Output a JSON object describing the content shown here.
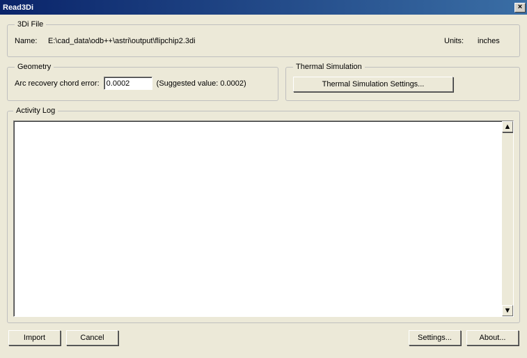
{
  "titlebar": {
    "title": "Read3Di",
    "close_label": "×"
  },
  "file_group": {
    "legend": "3Di File",
    "name_label": "Name:",
    "file_path": "E:\\cad_data\\odb++\\astri\\output\\flipchip2.3di",
    "units_label": "Units:",
    "units_value": "inches"
  },
  "geometry": {
    "legend": "Geometry",
    "arc_label": "Arc recovery chord error:",
    "arc_value": "0.0002",
    "suggested": "(Suggested value: 0.0002)"
  },
  "thermal": {
    "legend": "Thermal Simulation",
    "button_label": "Thermal Simulation Settings..."
  },
  "activity": {
    "legend": "Activity Log",
    "content": ""
  },
  "buttons": {
    "import": "Import",
    "cancel": "Cancel",
    "settings": "Settings...",
    "about": "About..."
  }
}
